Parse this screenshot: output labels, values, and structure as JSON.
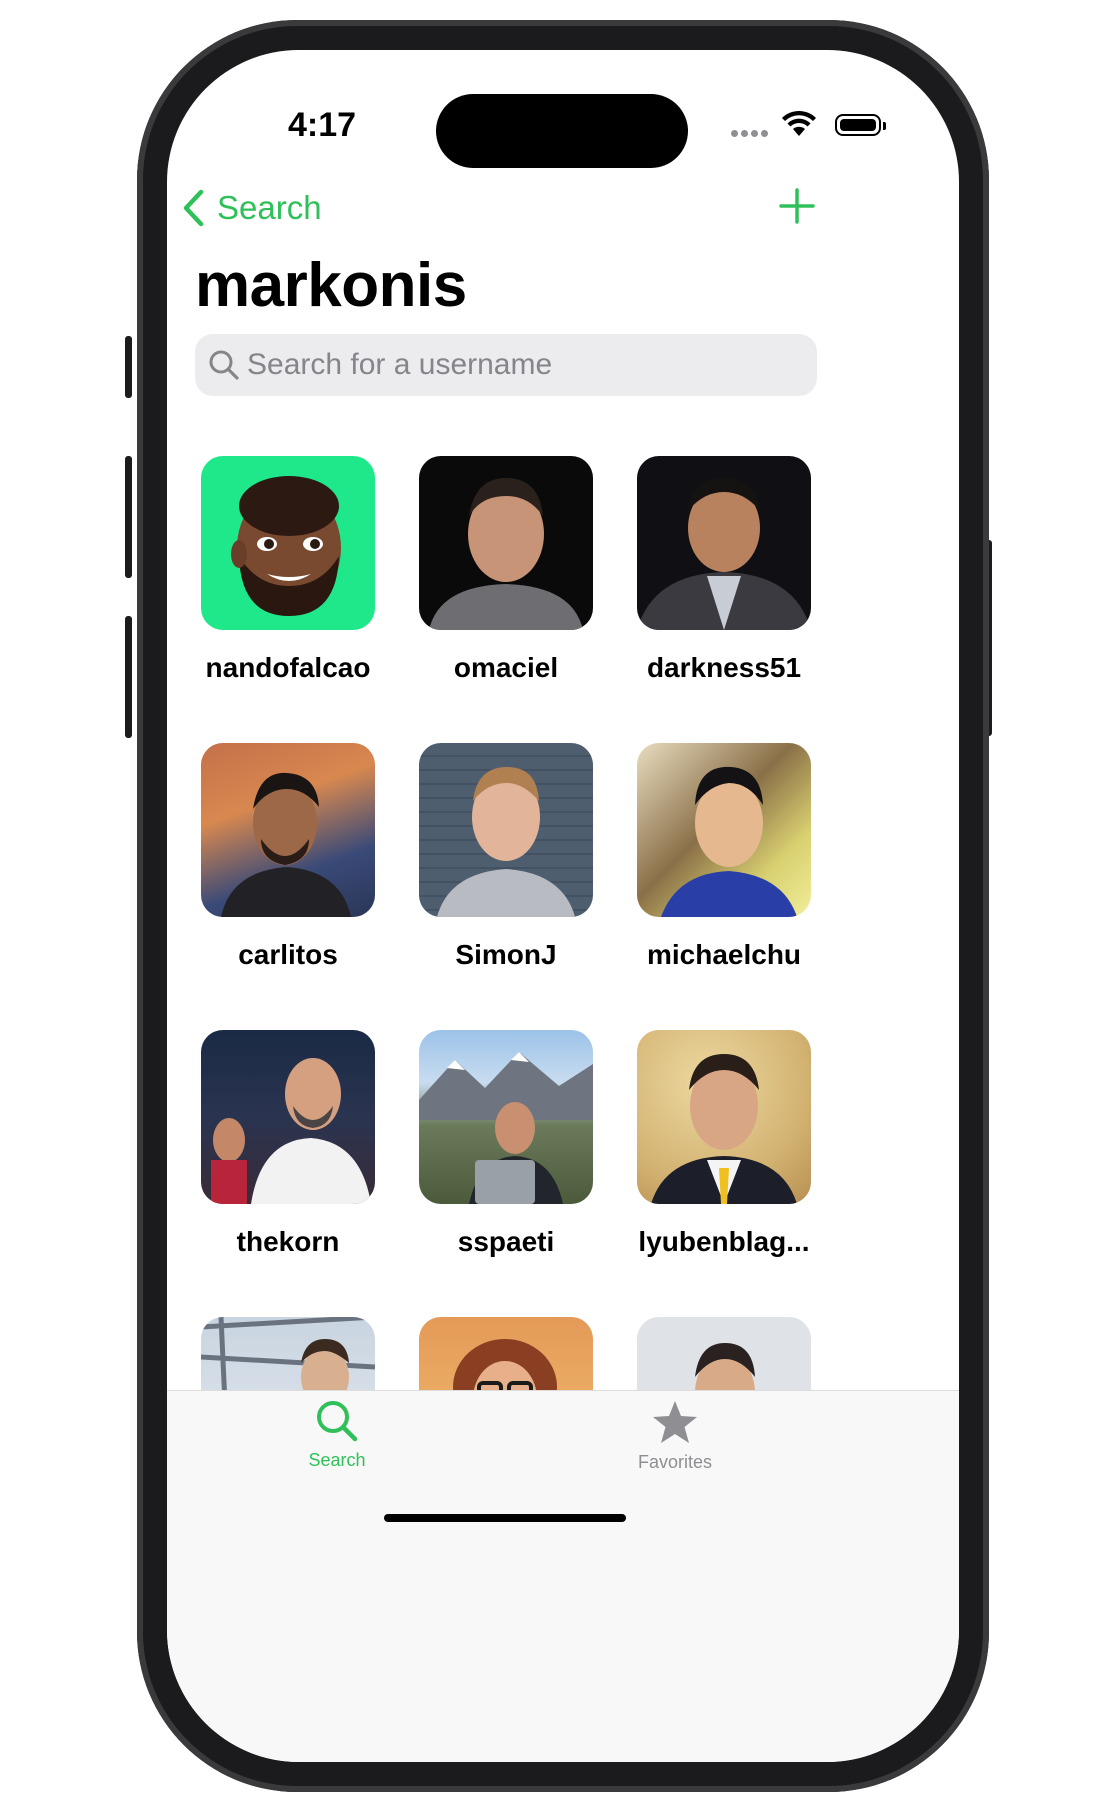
{
  "status_bar": {
    "time": "4:17"
  },
  "nav": {
    "back_label": "Search"
  },
  "page": {
    "title": "markonis"
  },
  "search": {
    "placeholder": "Search for a username",
    "value": ""
  },
  "users": [
    {
      "username": "nandofalcao"
    },
    {
      "username": "omaciel"
    },
    {
      "username": "darkness51"
    },
    {
      "username": "carlitos"
    },
    {
      "username": "SimonJ"
    },
    {
      "username": "michaelchu"
    },
    {
      "username": "thekorn"
    },
    {
      "username": "sspaeti"
    },
    {
      "username": "lyubenblag..."
    }
  ],
  "tabs": [
    {
      "label": "Search",
      "selected": true
    },
    {
      "label": "Favorites",
      "selected": false
    }
  ],
  "colors": {
    "accent": "#30c05a",
    "inactive": "#8e8e93"
  }
}
